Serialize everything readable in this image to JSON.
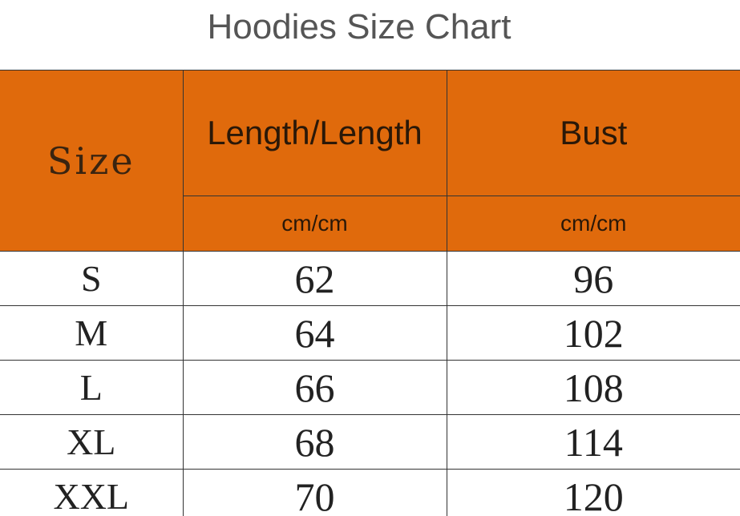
{
  "title": "Hoodies Size Chart",
  "table": {
    "size_header": "Size",
    "columns": [
      {
        "label": "Length/Length",
        "unit": "cm/cm"
      },
      {
        "label": "Bust",
        "unit": "cm/cm"
      }
    ],
    "rows": [
      {
        "size": "S",
        "length": "62",
        "bust": "96"
      },
      {
        "size": "M",
        "length": "64",
        "bust": "102"
      },
      {
        "size": "L",
        "length": "66",
        "bust": "108"
      },
      {
        "size": "XL",
        "length": "68",
        "bust": "114"
      },
      {
        "size": "XXL",
        "length": "70",
        "bust": "120"
      }
    ]
  },
  "colors": {
    "header_background": "#e06a0c",
    "title_text": "#555555",
    "grid_lines": "#333333"
  }
}
